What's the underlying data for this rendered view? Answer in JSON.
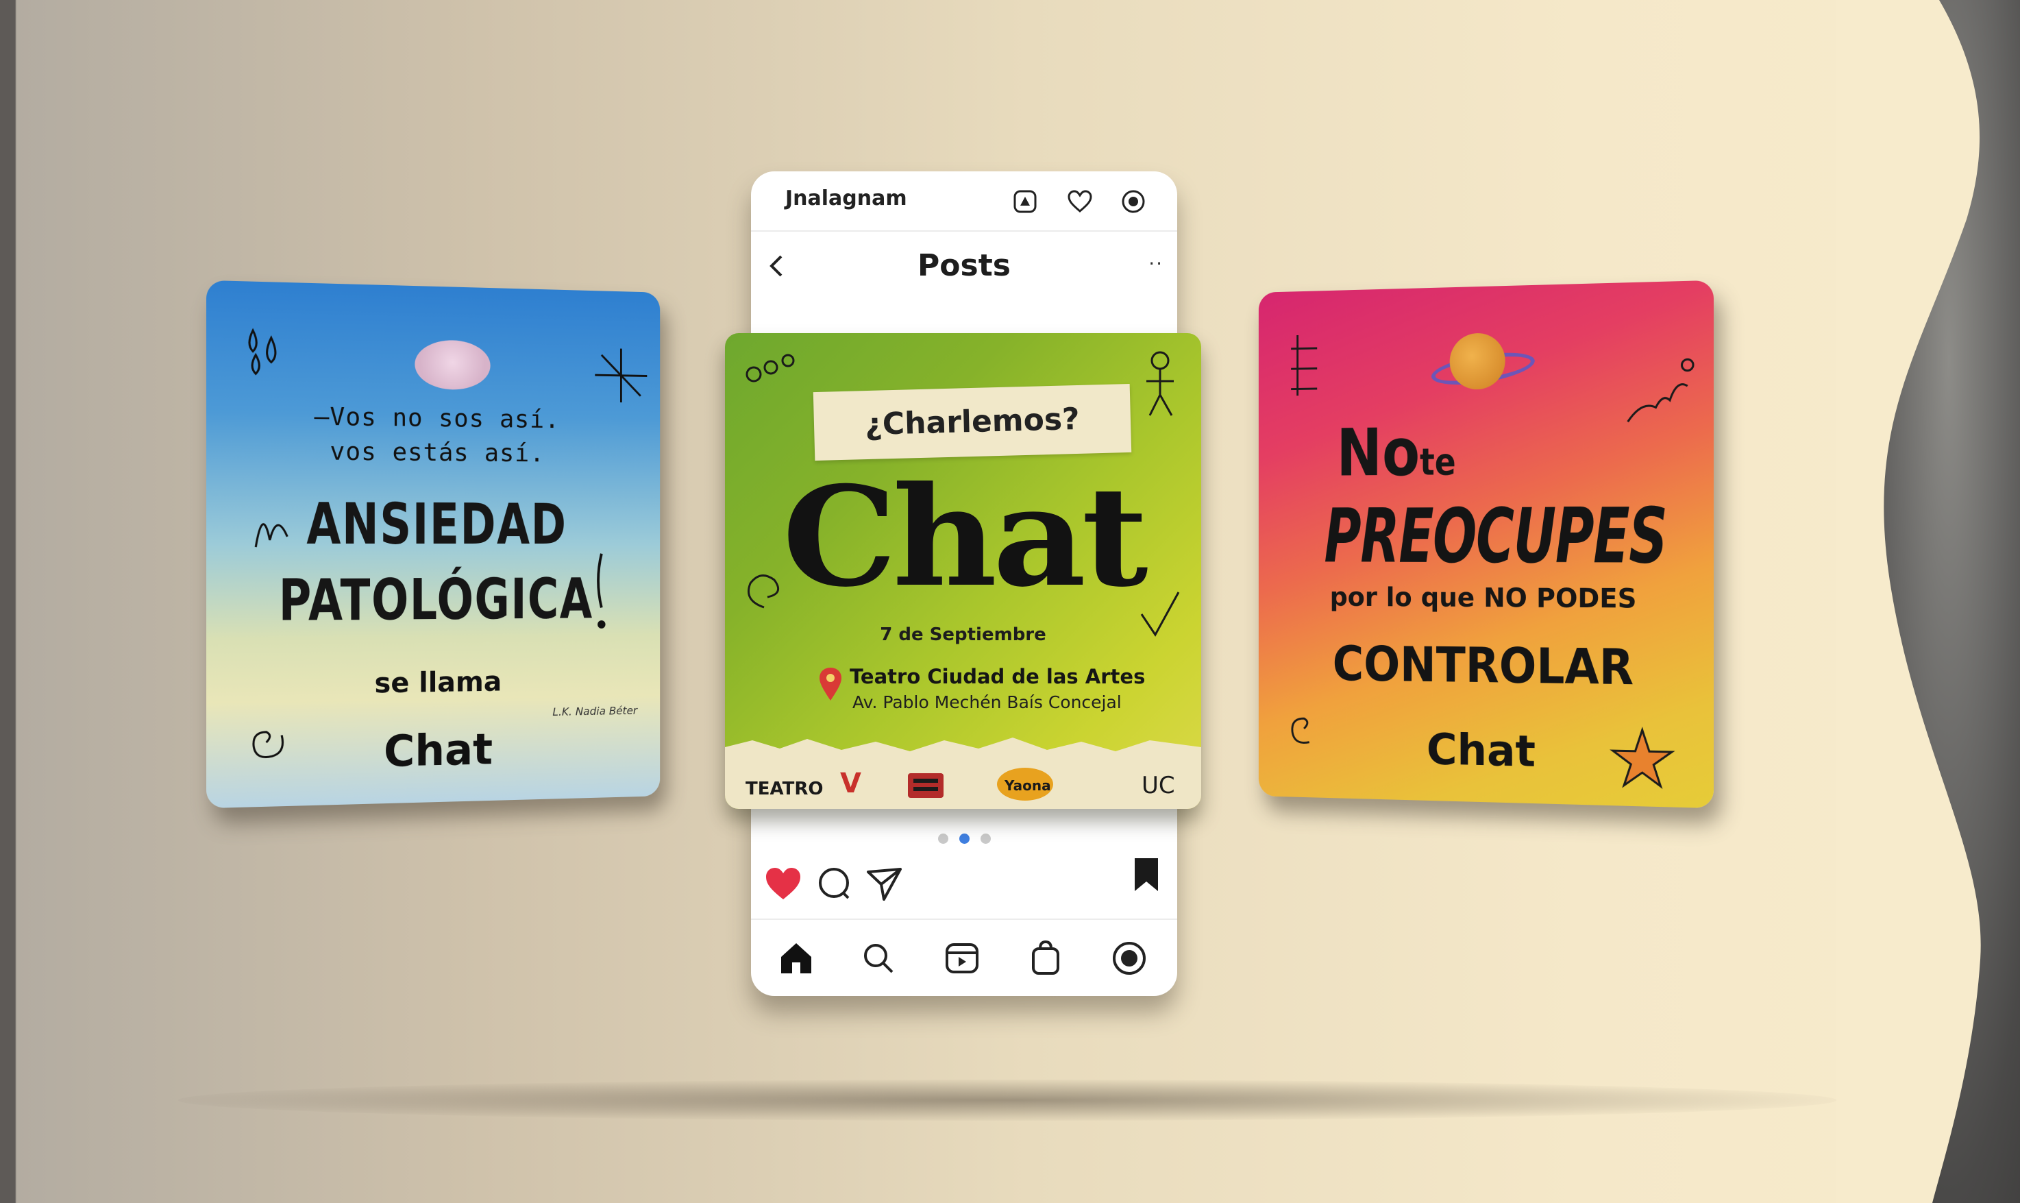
{
  "left_card": {
    "quote_line1": "–Vos no sos así.",
    "quote_line2": "vos estás así.",
    "headline_line1": "ANSIEDAD",
    "headline_line2": "PATOLÓGICA",
    "subline": "se llama",
    "author": "L.K. Nadia Béter",
    "brand": "Chat",
    "colors": {
      "top": "#2e7fd0",
      "bottom": "#e9e6b8"
    }
  },
  "phone": {
    "app_title": "Jnalagnam",
    "screen_title": "Posts",
    "more_label": "··",
    "carousel_dots": 3,
    "active_dot": 2,
    "icons": {
      "top": [
        "add-post-icon",
        "heart-outline-icon",
        "messenger-icon"
      ],
      "actions": [
        "heart-filled-icon",
        "comment-icon",
        "share-icon",
        "bookmark-icon"
      ],
      "nav": [
        "home-icon",
        "search-icon",
        "reels-icon",
        "shop-icon",
        "profile-icon"
      ]
    },
    "like_color": "#e53146"
  },
  "post": {
    "tag": "¿Charlemos?",
    "title": "Chat",
    "date": "7 de Septiembre",
    "venue": "Teatro Ciudad de las Artes",
    "address": "Av. Pablo Mechén Baís Concejal",
    "sponsors": [
      "TEATRO",
      "V",
      "Yaona",
      "UC"
    ],
    "colors": {
      "start": "#6ea82e",
      "end": "#dcd94a",
      "pin": "#d93a36"
    }
  },
  "right_card": {
    "line1_big": "No",
    "line1_small": "te",
    "line2": "PREOCUPES",
    "line3": "por lo que NO PODES",
    "line4": "CONTROLAR",
    "brand": "Chat",
    "colors": {
      "top": "#d6266f",
      "bottom": "#e6cc38",
      "star": "#e8822e"
    }
  }
}
